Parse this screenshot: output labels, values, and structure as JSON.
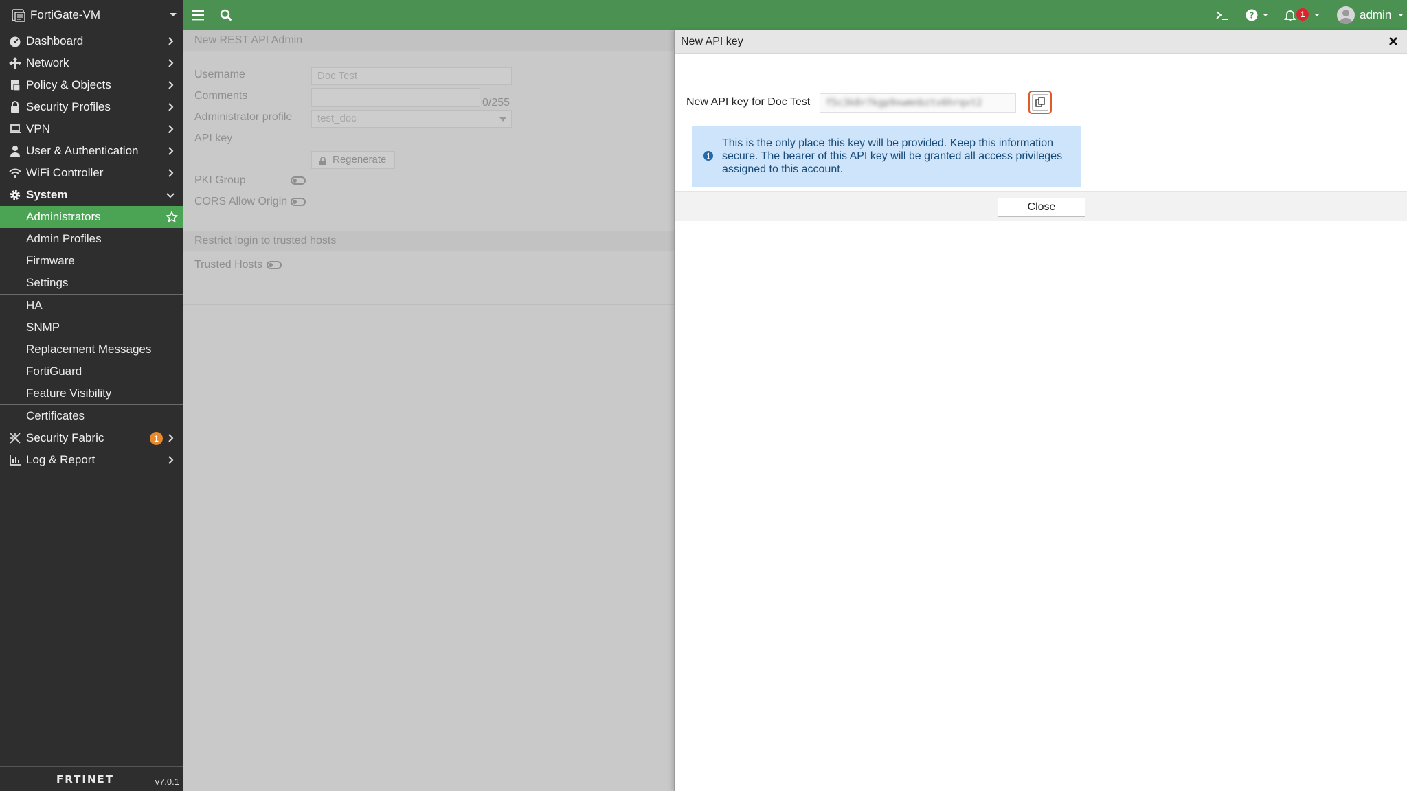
{
  "colors": {
    "sidebar_bg": "#2e2e2e",
    "topbar_bg": "#4b9252",
    "active_item_bg": "#4aa454",
    "info_bg": "#cde4fa",
    "copy_border": "#e25a2a",
    "badge_red": "#d9262e",
    "badge_orange": "#e8892c"
  },
  "sidebar": {
    "device_name": "FortiGate-VM",
    "device_icon": "server-icon",
    "nav": [
      {
        "label": "Dashboard",
        "icon": "dashboard-icon"
      },
      {
        "label": "Network",
        "icon": "network-icon"
      },
      {
        "label": "Policy & Objects",
        "icon": "policy-icon"
      },
      {
        "label": "Security Profiles",
        "icon": "lock-icon"
      },
      {
        "label": "VPN",
        "icon": "laptop-icon"
      },
      {
        "label": "User & Authentication",
        "icon": "user-icon"
      },
      {
        "label": "WiFi Controller",
        "icon": "wifi-icon"
      },
      {
        "label": "System",
        "icon": "gear-icon"
      }
    ],
    "system_sub": [
      "Administrators",
      "Admin Profiles",
      "Firmware",
      "Settings",
      "HA",
      "SNMP",
      "Replacement Messages",
      "FortiGuard",
      "Feature Visibility",
      "Certificates"
    ],
    "nav_after": [
      {
        "label": "Security Fabric",
        "icon": "fabric-icon",
        "badge": "1"
      },
      {
        "label": "Log & Report",
        "icon": "chart-icon"
      }
    ],
    "footer": {
      "logo": "FRTINET",
      "version": "v7.0.1"
    }
  },
  "topbar": {
    "notification_count": "1",
    "user": "admin"
  },
  "background_form": {
    "title": "New REST API Admin",
    "username_label": "Username",
    "username_value": "Doc Test",
    "comments_label": "Comments",
    "comments_counter": "0/255",
    "profile_label": "Administrator profile",
    "profile_value": "test_doc",
    "apikey_label": "API key",
    "regenerate_label": "Regenerate",
    "pki_label": "PKI Group",
    "cors_label": "CORS Allow Origin",
    "restrict_section": "Restrict login to trusted hosts",
    "trusted_hosts_label": "Trusted Hosts"
  },
  "dialog": {
    "title": "New API key",
    "key_label": "New API key for Doc Test",
    "key_value": "f5c3k8r7kgp9xwmnbztv6hrqxt2",
    "info_text": "This is the only place this key will be provided. Keep this information secure. The bearer of this API key will be granted all access privileges assigned to this account.",
    "close_label": "Close"
  }
}
